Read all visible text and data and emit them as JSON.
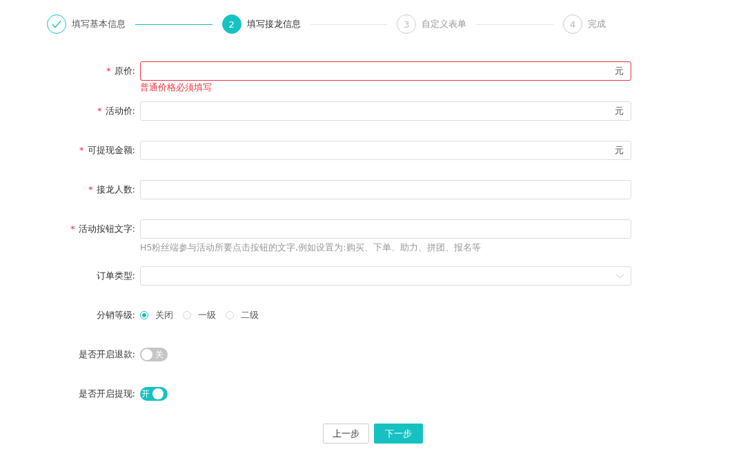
{
  "steps": [
    {
      "label": "填写基本信息",
      "done": true,
      "selected": false
    },
    {
      "number": "2",
      "label": "填写接龙信息",
      "done": false,
      "selected": true
    },
    {
      "number": "3",
      "label": "自定义表单",
      "done": false,
      "selected": false
    },
    {
      "number": "4",
      "label": "完成",
      "done": false,
      "selected": false
    }
  ],
  "form": {
    "items": [
      {
        "kind": "input",
        "label": "原价:",
        "required_mark": "*",
        "suffix": "元",
        "error": "普通价格必须填写"
      },
      {
        "kind": "input",
        "label": "活动价:",
        "required_mark": "*",
        "suffix": "元"
      },
      {
        "kind": "input",
        "label": "可提现金额:",
        "required_mark": "*",
        "suffix": "元"
      },
      {
        "kind": "input",
        "label": "接龙人数:",
        "required_mark": "*"
      },
      {
        "kind": "input",
        "label": "活动按钮文字:",
        "required_mark": "*",
        "help": "H5粉丝端参与活动所要点击按钮的文字,例如设置为:购买、下单、助力、拼团、报名等"
      },
      {
        "kind": "select",
        "label": "订单类型:"
      },
      {
        "kind": "radio",
        "label": "分销等级:",
        "options": [
          {
            "label": "关闭",
            "selected": true
          },
          {
            "label": "一级",
            "selected": false
          },
          {
            "label": "二级",
            "selected": false
          }
        ]
      },
      {
        "kind": "switch",
        "label": "是否开启退款:",
        "on": false,
        "text": "关"
      },
      {
        "kind": "switch",
        "label": "是否开启提现:",
        "on": true,
        "text": "开"
      }
    ]
  },
  "buttons": [
    {
      "label": "上一步",
      "kind": "default"
    },
    {
      "label": "下一步",
      "kind": "primary"
    }
  ]
}
